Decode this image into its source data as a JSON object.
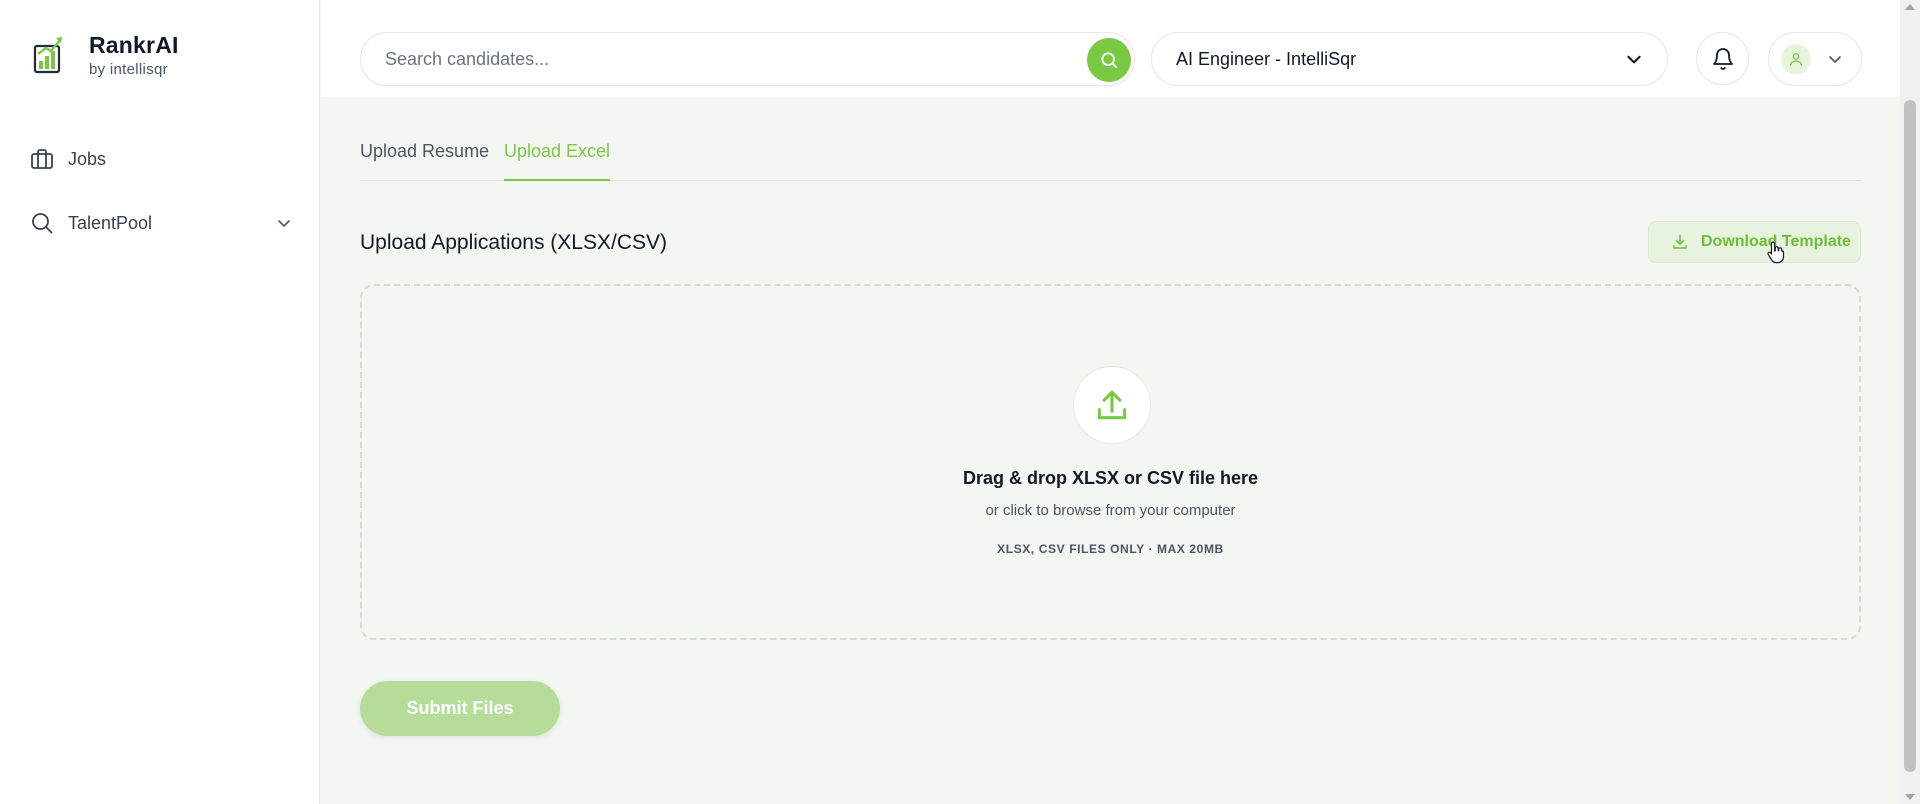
{
  "sidebar": {
    "brand_name": "RankrAI",
    "brand_sub": "by intellisqr",
    "items": [
      {
        "label": "Jobs",
        "icon": "briefcase-icon"
      },
      {
        "label": "TalentPool",
        "icon": "search-icon",
        "expandable": true
      }
    ]
  },
  "header": {
    "search_placeholder": "Search candidates...",
    "job_selected": "AI Engineer - IntelliSqr"
  },
  "main": {
    "tabs": [
      {
        "label": "Upload Resume",
        "active": false
      },
      {
        "label": "Upload Excel",
        "active": true
      }
    ],
    "section_title": "Upload Applications (XLSX/CSV)",
    "download_label": "Download Template",
    "dropzone": {
      "title": "Drag & drop XLSX or CSV file here",
      "subtitle": "or click to browse from your computer",
      "note": "XLSX, CSV FILES ONLY · MAX 20MB"
    },
    "submit_label": "Submit Files"
  },
  "colors": {
    "accent": "#7ac943",
    "accent_light": "#e8f3df",
    "submit_disabled": "#b5dd99",
    "background": "#f3f6f1"
  }
}
